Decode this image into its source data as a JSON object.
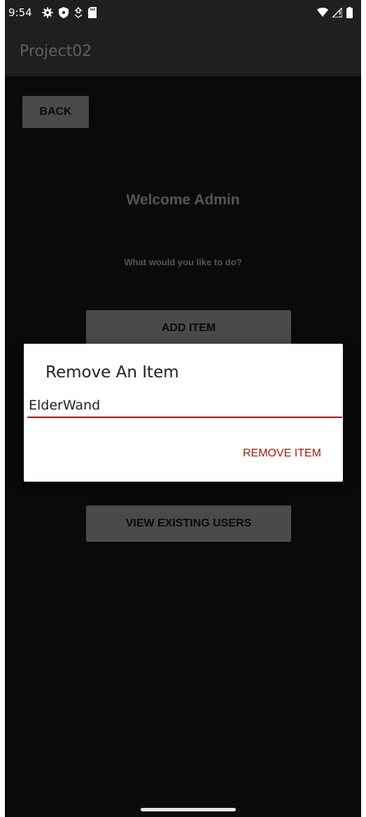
{
  "status_bar": {
    "time": "9:54",
    "icons_left": [
      "gear-icon",
      "shield-icon",
      "download-icon",
      "sd-card-icon"
    ],
    "icons_right": [
      "wifi-icon",
      "signal-icon",
      "battery-icon"
    ]
  },
  "app_bar": {
    "title": "Project02"
  },
  "screen": {
    "back_label": "BACK",
    "welcome": "Welcome Admin",
    "prompt": "What would you like to do?",
    "add_item_label": "ADD ITEM",
    "view_users_label": "VIEW EXISTING USERS"
  },
  "dialog": {
    "title": "Remove An Item",
    "input_value": "ElderWand",
    "action_label": "REMOVE ITEM",
    "accent_color": "#a51a06"
  }
}
